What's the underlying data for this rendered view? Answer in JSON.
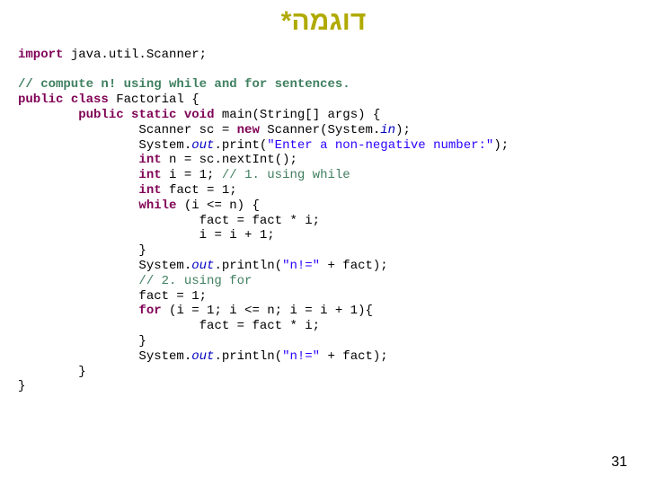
{
  "title": "דוגמה*",
  "page_number": "31",
  "code": {
    "l01_kw": "import",
    "l01_rest": " java.util.Scanner;",
    "l03_cm": "// compute n! using while and for sentences.",
    "l04_kw1": "public",
    "l04_kw2": "class",
    "l04_rest": " Factorial {",
    "l05_pad": "        ",
    "l05_kw1": "public",
    "l05_kw2": "static",
    "l05_kw3": "void",
    "l05_rest": " main(String[] args) {",
    "l06_pad": "                ",
    "l06_a": "Scanner sc = ",
    "l06_kw": "new",
    "l06_b": " Scanner(System.",
    "l06_sf": "in",
    "l06_c": ");",
    "l07_pad": "                ",
    "l07_a": "System.",
    "l07_sf": "out",
    "l07_b": ".print(",
    "l07_str": "\"Enter a non-negative number:\"",
    "l07_c": ");",
    "l08_pad": "                ",
    "l08_kw": "int",
    "l08_rest": " n = sc.nextInt();",
    "l09_pad": "                ",
    "l09_kw": "int",
    "l09_a": " i = 1; ",
    "l09_cm": "// 1. using while",
    "l10_pad": "                ",
    "l10_kw": "int",
    "l10_rest": " fact = 1;",
    "l11_pad": "                ",
    "l11_kw": "while",
    "l11_rest": " (i <= n) {",
    "l12_pad": "                        ",
    "l12_rest": "fact = fact * i;",
    "l13_pad": "                        ",
    "l13_rest": "i = i + 1;",
    "l14_pad": "                ",
    "l14_rest": "}",
    "l15_pad": "                ",
    "l15_a": "System.",
    "l15_sf": "out",
    "l15_b": ".println(",
    "l15_str": "\"n!=\"",
    "l15_c": " + fact);",
    "l16_pad": "                ",
    "l16_cm": "// 2. using for",
    "l17_pad": "                ",
    "l17_rest": "fact = 1;",
    "l18_pad": "                ",
    "l18_kw": "for",
    "l18_rest": " (i = 1; i <= n; i = i + 1){",
    "l19_pad": "                        ",
    "l19_rest": "fact = fact * i;",
    "l20_pad": "                ",
    "l20_rest": "}",
    "l21_pad": "                ",
    "l21_a": "System.",
    "l21_sf": "out",
    "l21_b": ".println(",
    "l21_str": "\"n!=\"",
    "l21_c": " + fact);",
    "l22_pad": "        ",
    "l22_rest": "}",
    "l23_rest": "}"
  }
}
